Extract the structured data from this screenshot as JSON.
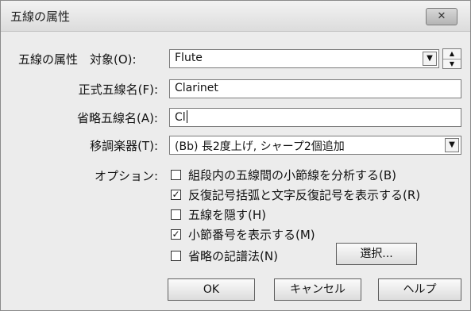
{
  "window": {
    "title": "五線の属性",
    "close_label": "✕"
  },
  "form": {
    "target_label": "五線の属性　対象(O):",
    "target_value": "Flute",
    "full_name_label": "正式五線名(F):",
    "full_name_value": "Clarinet",
    "abbr_name_label": "省略五線名(A):",
    "abbr_name_value": "Cl",
    "transpose_label": "移調楽器(T):",
    "transpose_value": "(Bb) 長2度上げ, シャープ2個追加",
    "options_label": "オプション:",
    "options": [
      {
        "label": "組段内の五線間の小節線を分析する(B)",
        "checked": false
      },
      {
        "label": "反復記号括弧と文字反復記号を表示する(R)",
        "checked": true
      },
      {
        "label": "五線を隠す(H)",
        "checked": false
      },
      {
        "label": "小節番号を表示する(M)",
        "checked": true
      },
      {
        "label": "省略の記譜法(N)",
        "checked": false
      }
    ],
    "select_button": "選択...",
    "dropdown_arrow": "▼",
    "spin_up": "▲",
    "spin_down": "▼"
  },
  "buttons": {
    "ok": "OK",
    "cancel": "キャンセル",
    "help": "ヘルプ"
  }
}
